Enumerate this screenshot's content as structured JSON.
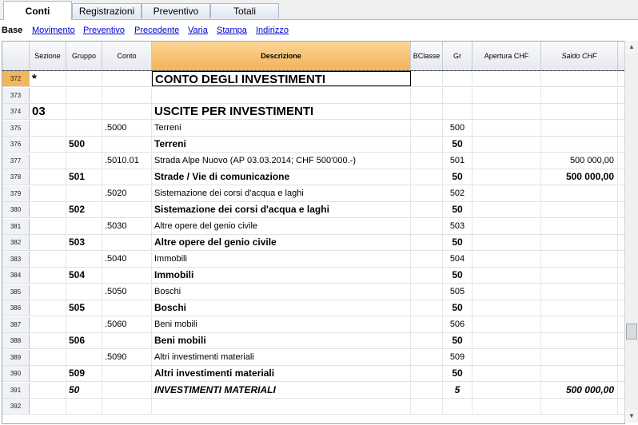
{
  "tabs": [
    {
      "label": "Conti",
      "active": true
    },
    {
      "label": "Registrazioni",
      "active": false
    },
    {
      "label": "Preventivo",
      "active": false
    },
    {
      "label": "Totali",
      "active": false
    }
  ],
  "views": {
    "base": "Base",
    "links": [
      "Movimento",
      "Preventivo",
      "Precedente",
      "Varia",
      "Stampa",
      "Indirizzo"
    ]
  },
  "columns": {
    "sezione": "Sezione",
    "gruppo": "Gruppo",
    "conto": "Conto",
    "descrizione": "Descrizione",
    "bclasse": "BClasse",
    "gr": "Gr",
    "apertura": "Apertura CHF",
    "saldo": "Saldo CHF"
  },
  "rows": [
    {
      "n": "372",
      "sez": "*",
      "grp": "",
      "cnt": "",
      "desc": "CONTO DEGLI INVESTIMENTI",
      "bcl": "",
      "gr": "",
      "ap": "",
      "saldo": "",
      "style": "big"
    },
    {
      "n": "373",
      "sez": "",
      "grp": "",
      "cnt": "",
      "desc": "",
      "bcl": "",
      "gr": "",
      "ap": "",
      "saldo": "",
      "style": "norm"
    },
    {
      "n": "374",
      "sez": "03",
      "grp": "",
      "cnt": "",
      "desc": "USCITE PER INVESTIMENTI",
      "bcl": "",
      "gr": "",
      "ap": "",
      "saldo": "",
      "style": "big"
    },
    {
      "n": "375",
      "sez": "",
      "grp": "",
      "cnt": ".5000",
      "desc": "Terreni",
      "bcl": "",
      "gr": "500",
      "ap": "",
      "saldo": "",
      "style": "norm"
    },
    {
      "n": "376",
      "sez": "",
      "grp": "500",
      "cnt": "",
      "desc": "Terreni",
      "bcl": "",
      "gr": "50",
      "ap": "",
      "saldo": "",
      "style": "bold"
    },
    {
      "n": "377",
      "sez": "",
      "grp": "",
      "cnt": ".5010.01",
      "desc": "Strada Alpe Nuovo (AP 03.03.2014; CHF 500'000.-)",
      "bcl": "",
      "gr": "501",
      "ap": "",
      "saldo": "500 000,00",
      "style": "norm"
    },
    {
      "n": "378",
      "sez": "",
      "grp": "501",
      "cnt": "",
      "desc": "Strade / Vie di comunicazione",
      "bcl": "",
      "gr": "50",
      "ap": "",
      "saldo": "500 000,00",
      "style": "bold"
    },
    {
      "n": "379",
      "sez": "",
      "grp": "",
      "cnt": ".5020",
      "desc": "Sistemazione dei corsi d'acqua e laghi",
      "bcl": "",
      "gr": "502",
      "ap": "",
      "saldo": "",
      "style": "norm"
    },
    {
      "n": "380",
      "sez": "",
      "grp": "502",
      "cnt": "",
      "desc": "Sistemazione dei corsi d'acqua e laghi",
      "bcl": "",
      "gr": "50",
      "ap": "",
      "saldo": "",
      "style": "bold"
    },
    {
      "n": "381",
      "sez": "",
      "grp": "",
      "cnt": ".5030",
      "desc": "Altre opere del genio civile",
      "bcl": "",
      "gr": "503",
      "ap": "",
      "saldo": "",
      "style": "norm"
    },
    {
      "n": "382",
      "sez": "",
      "grp": "503",
      "cnt": "",
      "desc": "Altre opere del genio civile",
      "bcl": "",
      "gr": "50",
      "ap": "",
      "saldo": "",
      "style": "bold"
    },
    {
      "n": "383",
      "sez": "",
      "grp": "",
      "cnt": ".5040",
      "desc": "Immobili",
      "bcl": "",
      "gr": "504",
      "ap": "",
      "saldo": "",
      "style": "norm"
    },
    {
      "n": "384",
      "sez": "",
      "grp": "504",
      "cnt": "",
      "desc": "Immobili",
      "bcl": "",
      "gr": "50",
      "ap": "",
      "saldo": "",
      "style": "bold"
    },
    {
      "n": "385",
      "sez": "",
      "grp": "",
      "cnt": ".5050",
      "desc": "Boschi",
      "bcl": "",
      "gr": "505",
      "ap": "",
      "saldo": "",
      "style": "norm"
    },
    {
      "n": "386",
      "sez": "",
      "grp": "505",
      "cnt": "",
      "desc": "Boschi",
      "bcl": "",
      "gr": "50",
      "ap": "",
      "saldo": "",
      "style": "bold"
    },
    {
      "n": "387",
      "sez": "",
      "grp": "",
      "cnt": ".5060",
      "desc": "Beni mobili",
      "bcl": "",
      "gr": "506",
      "ap": "",
      "saldo": "",
      "style": "norm"
    },
    {
      "n": "388",
      "sez": "",
      "grp": "506",
      "cnt": "",
      "desc": "Beni mobili",
      "bcl": "",
      "gr": "50",
      "ap": "",
      "saldo": "",
      "style": "bold"
    },
    {
      "n": "389",
      "sez": "",
      "grp": "",
      "cnt": ".5090",
      "desc": "Altri investimenti materiali",
      "bcl": "",
      "gr": "509",
      "ap": "",
      "saldo": "",
      "style": "norm"
    },
    {
      "n": "390",
      "sez": "",
      "grp": "509",
      "cnt": "",
      "desc": "Altri investimenti materiali",
      "bcl": "",
      "gr": "50",
      "ap": "",
      "saldo": "",
      "style": "bold"
    },
    {
      "n": "391",
      "sez": "",
      "grp": "50",
      "cnt": "",
      "desc": "INVESTIMENTI MATERIALI",
      "bcl": "",
      "gr": "5",
      "ap": "",
      "saldo": "500 000,00",
      "style": "bi"
    },
    {
      "n": "392",
      "sez": "",
      "grp": "",
      "cnt": "",
      "desc": "",
      "bcl": "",
      "gr": "",
      "ap": "",
      "saldo": "",
      "style": "norm"
    }
  ],
  "selected_row": "372",
  "icons": {
    "scroll_up": "chevron-up-icon",
    "scroll_down": "chevron-down-icon"
  }
}
